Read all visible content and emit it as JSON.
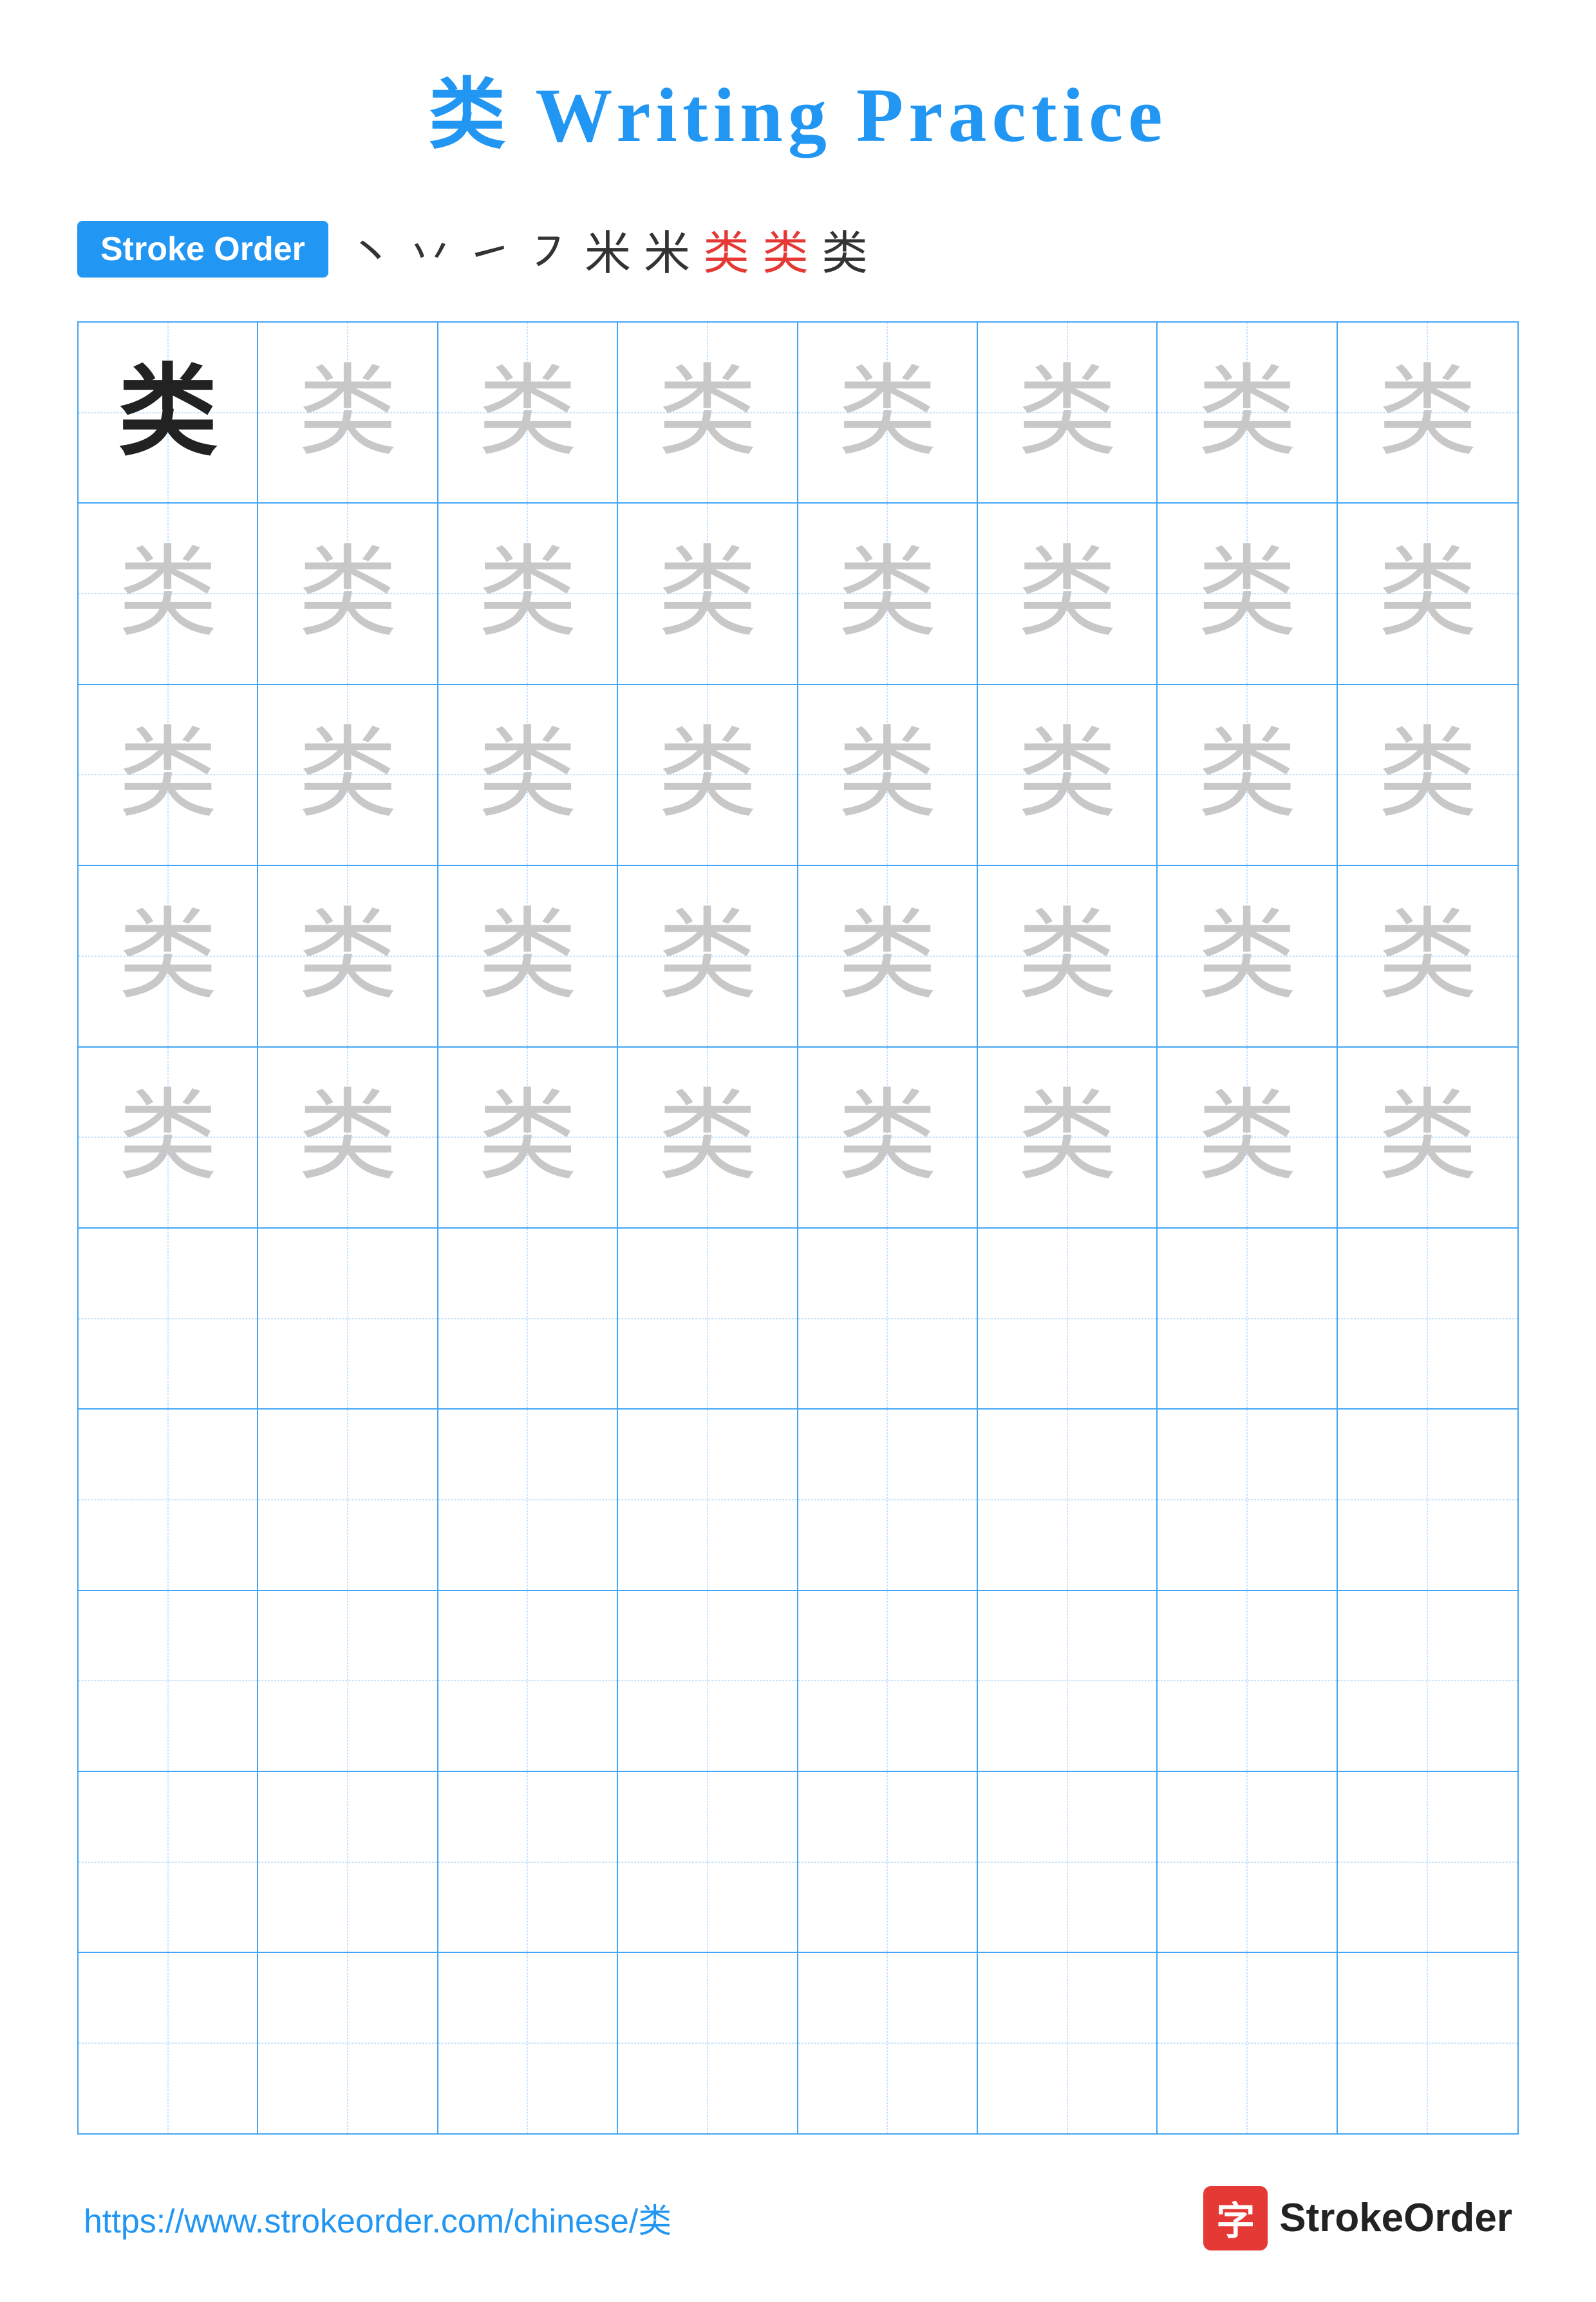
{
  "page": {
    "title": "类 Writing Practice",
    "url": "https://www.strokeorder.com/chinese/类"
  },
  "stroke_order": {
    "badge_label": "Stroke Order",
    "strokes": [
      "丶",
      "丶",
      "㇀",
      "㇇",
      "㇇",
      "米",
      "类",
      "类",
      "类"
    ]
  },
  "grid": {
    "rows": 10,
    "cols": 8,
    "character": "类",
    "filled_rows_dark": 1,
    "filled_rows_light": 4,
    "empty_rows": 5
  },
  "footer": {
    "url": "https://www.strokeorder.com/chinese/类",
    "logo_char": "字",
    "logo_text": "StrokeOrder"
  }
}
